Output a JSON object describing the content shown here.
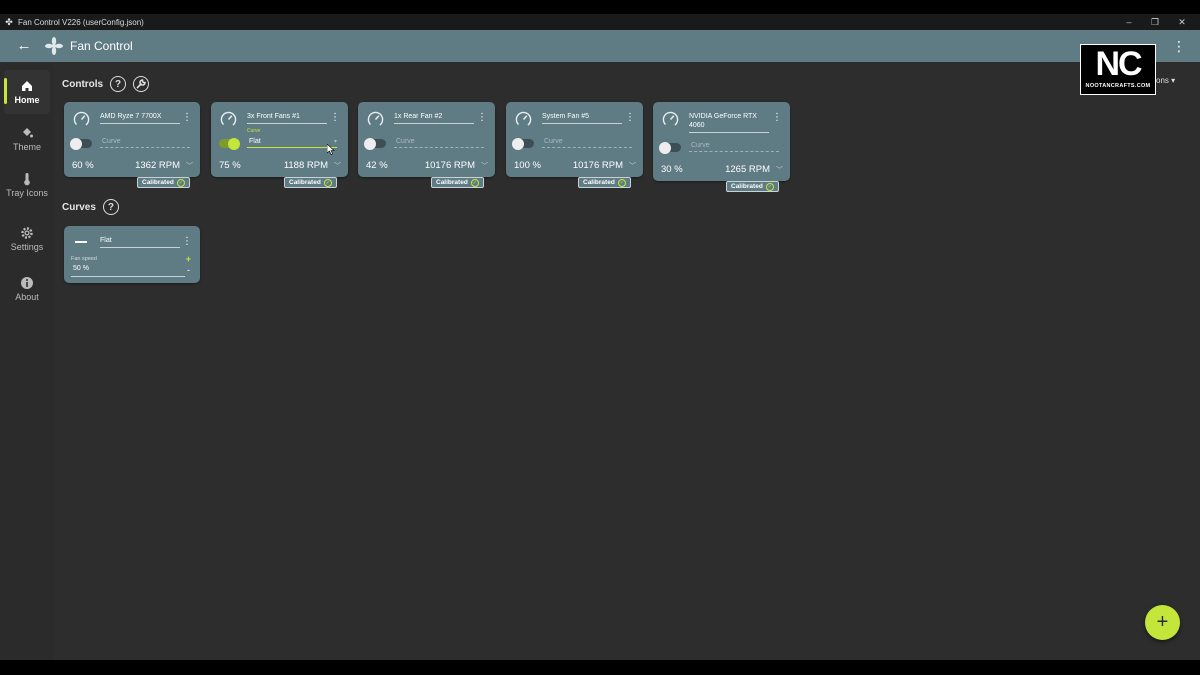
{
  "window": {
    "title": "Fan Control V226 (userConfig.json)",
    "minimize": "–",
    "maximize": "❐",
    "close": "✕"
  },
  "appbar": {
    "title": "Fan Control",
    "back": "←",
    "menu": "⋮"
  },
  "sidebar": {
    "items": [
      {
        "label": "Home"
      },
      {
        "label": "Theme"
      },
      {
        "label": "Tray Icons"
      },
      {
        "label": "Settings"
      },
      {
        "label": "About"
      }
    ]
  },
  "sections": {
    "controls": "Controls",
    "curves": "Curves",
    "help": "?",
    "options_partial": "ons ▾"
  },
  "controls": [
    {
      "name": "AMD Ryze 7 7700X",
      "curve_placeholder": "Curve",
      "curve_value": "",
      "enabled": false,
      "percent": "60 %",
      "rpm": "1362 RPM",
      "badge": "Calibrated"
    },
    {
      "name": "3x Front  Fans #1",
      "curve_placeholder": "Curve",
      "curve_value": "Flat",
      "enabled": true,
      "percent": "75 %",
      "rpm": "1188 RPM",
      "badge": "Calibrated"
    },
    {
      "name": "1x Rear Fan #2",
      "curve_placeholder": "Curve",
      "curve_value": "",
      "enabled": false,
      "percent": "42 %",
      "rpm": "10176 RPM",
      "badge": "Calibrated"
    },
    {
      "name": "System Fan #5",
      "curve_placeholder": "Curve",
      "curve_value": "",
      "enabled": false,
      "percent": "100 %",
      "rpm": "10176 RPM",
      "badge": "Calibrated"
    },
    {
      "name": "NVIDIA GeForce RTX 4060",
      "curve_placeholder": "Curve",
      "curve_value": "",
      "enabled": false,
      "percent": "30 %",
      "rpm": "1265 RPM",
      "badge": "Calibrated"
    }
  ],
  "curves": [
    {
      "name": "Flat",
      "fan_speed_label": "Fan speed",
      "fan_speed_value": "50 %",
      "plus": "+",
      "minus": "-"
    }
  ],
  "fab": {
    "label": "+"
  },
  "watermark": {
    "big": "NC",
    "small": "NOOTANCRAFTS.COM"
  },
  "colors": {
    "accent": "#c4e63a",
    "card": "#5f7b84",
    "background": "#2d2d2d",
    "sidebar": "#2b2b2b"
  }
}
